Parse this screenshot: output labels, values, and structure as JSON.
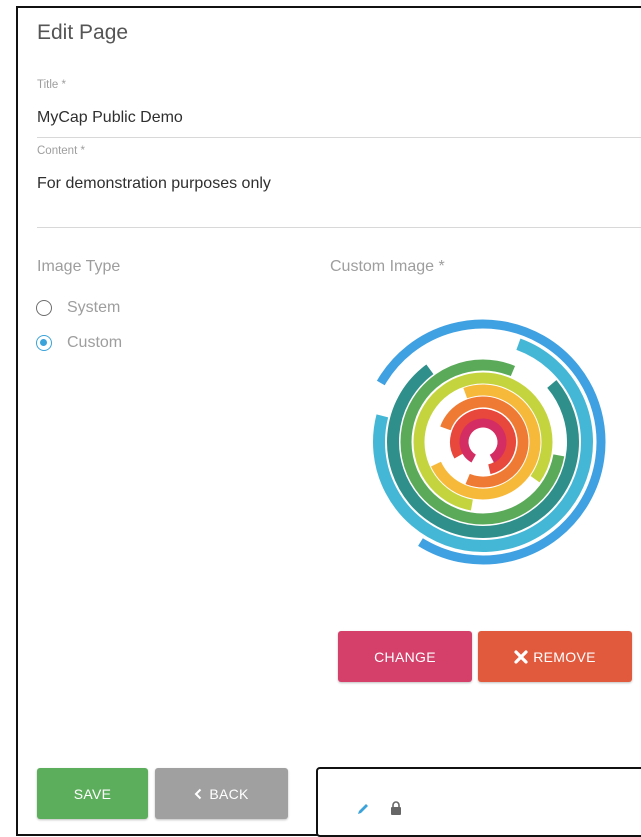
{
  "page": {
    "title": "Edit Page"
  },
  "form": {
    "title_label": "Title *",
    "title_value": "MyCap Public Demo",
    "content_label": "Content *",
    "content_value": "For demonstration purposes only",
    "image_type_label": "Image Type",
    "options": [
      {
        "label": "System",
        "checked": false
      },
      {
        "label": "Custom",
        "checked": true
      }
    ],
    "custom_image_label": "Custom Image *"
  },
  "image_buttons": {
    "change": "CHANGE",
    "remove": "REMOVE"
  },
  "actions": {
    "save": "SAVE",
    "back": "BACK"
  },
  "colors": {
    "accent_blue": "#3aa3da",
    "save_green": "#5cad5c",
    "back_gray": "#a0a0a0",
    "change_pink": "#d4406a",
    "remove_orange": "#e25a3d"
  },
  "icons": [
    "x-icon",
    "chevron-left-icon",
    "pencil-icon",
    "lock-icon"
  ]
}
